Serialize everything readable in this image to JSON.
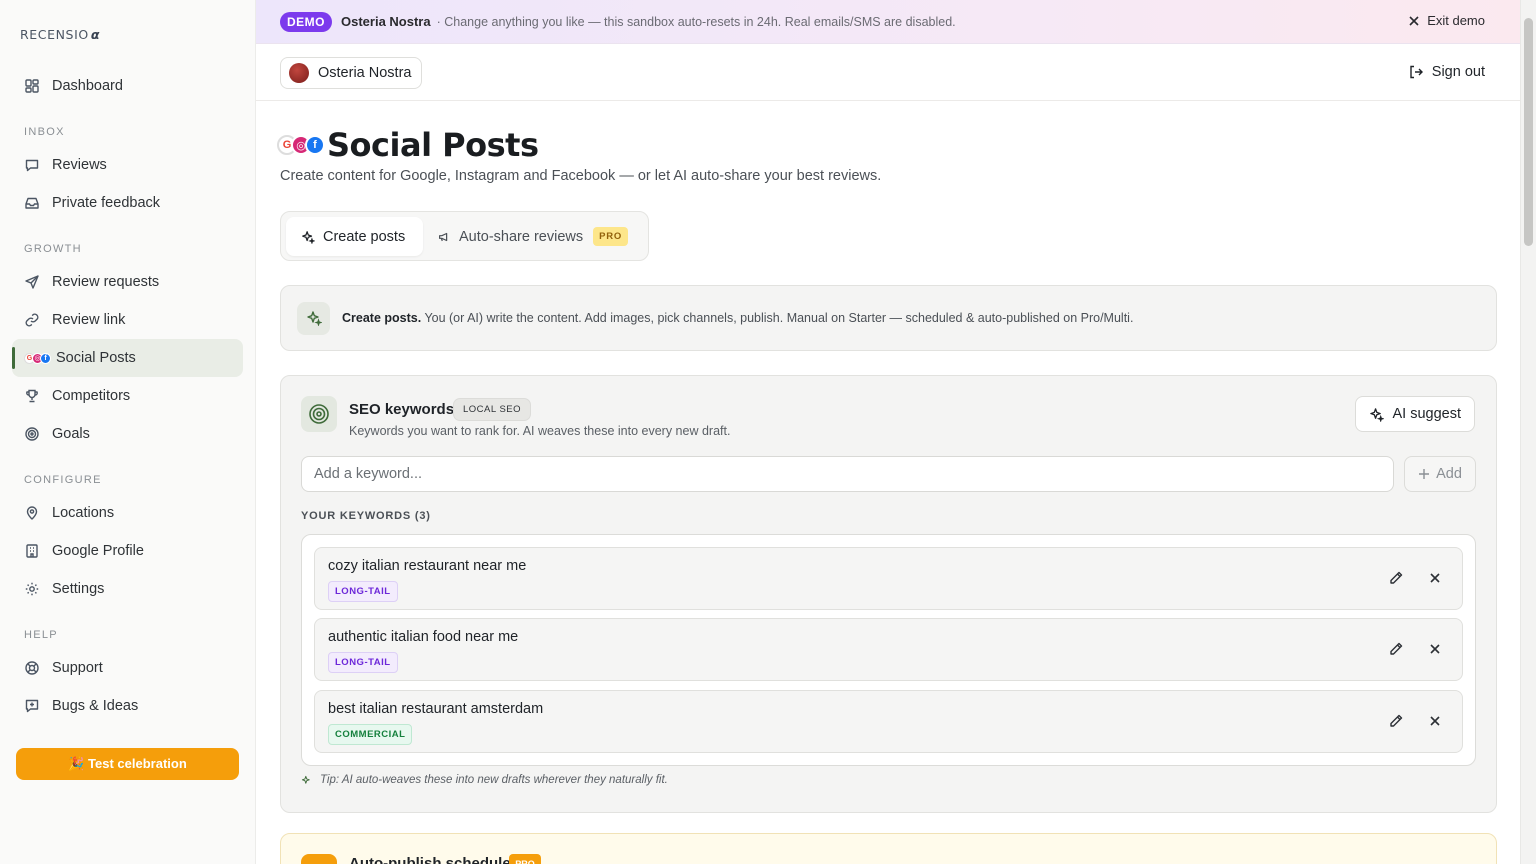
{
  "brand": {
    "logo_text": "RECENSIO",
    "logo_mark": "α"
  },
  "banner": {
    "badge": "DEMO",
    "business": "Osteria Nostra",
    "message": "· Change anything you like — this sandbox auto-resets in 24h. Real emails/SMS are disabled.",
    "exit_label": "Exit demo"
  },
  "topbar": {
    "location": "Osteria Nostra",
    "signout_label": "Sign out"
  },
  "sidebar": {
    "dashboard": "Dashboard",
    "sections": {
      "inbox": "INBOX",
      "growth": "GROWTH",
      "configure": "CONFIGURE",
      "help": "HELP"
    },
    "items": [
      {
        "label": "Reviews",
        "icon": "message-icon"
      },
      {
        "label": "Private feedback",
        "icon": "inbox-icon"
      },
      {
        "label": "Review requests",
        "icon": "send-icon"
      },
      {
        "label": "Review link",
        "icon": "link-icon"
      },
      {
        "label": "Social Posts",
        "icon": "social-icons",
        "active": true
      },
      {
        "label": "Competitors",
        "icon": "trophy-icon"
      },
      {
        "label": "Goals",
        "icon": "target-icon"
      },
      {
        "label": "Locations",
        "icon": "map-pin-icon"
      },
      {
        "label": "Google Profile",
        "icon": "building-icon"
      },
      {
        "label": "Settings",
        "icon": "gear-icon"
      },
      {
        "label": "Support",
        "icon": "lifebuoy-icon"
      },
      {
        "label": "Bugs & Ideas",
        "icon": "message-plus-icon"
      }
    ],
    "test_button": "🎉 Test celebration"
  },
  "page": {
    "title": "Social Posts",
    "subtitle": "Create content for Google, Instagram and Facebook — or let AI auto-share your best reviews.",
    "tabs": [
      {
        "label": "Create posts",
        "active": true
      },
      {
        "label": "Auto-share reviews",
        "badge": "PRO"
      }
    ],
    "info": {
      "bold": "Create posts.",
      "text": " You (or AI) write the content. Add images, pick channels, publish. Manual on Starter — scheduled & auto-published on Pro/Multi."
    }
  },
  "seo": {
    "title": "SEO keywords",
    "badge": "LOCAL SEO",
    "subtitle": "Keywords you want to rank for. AI weaves these into every new draft.",
    "ai_suggest": "AI suggest",
    "input_placeholder": "Add a keyword...",
    "add_label": "Add",
    "list_label": "YOUR KEYWORDS (3)",
    "keywords": [
      {
        "text": "cozy italian restaurant near me",
        "tag": "LONG-TAIL"
      },
      {
        "text": "authentic italian food near me",
        "tag": "LONG-TAIL"
      },
      {
        "text": "best italian restaurant amsterdam",
        "tag": "COMMERCIAL"
      }
    ],
    "tip": "Tip: AI auto-weaves these into new drafts wherever they naturally fit."
  },
  "next_section": {
    "title": "Auto-publish schedule",
    "badge": "PRO"
  },
  "colors": {
    "accent_green": "#3f6b3a",
    "demo_purple": "#7c3aed",
    "orange": "#f59e0b",
    "longtail_purple": "#6d28d9",
    "commercial_green": "#15803d"
  }
}
